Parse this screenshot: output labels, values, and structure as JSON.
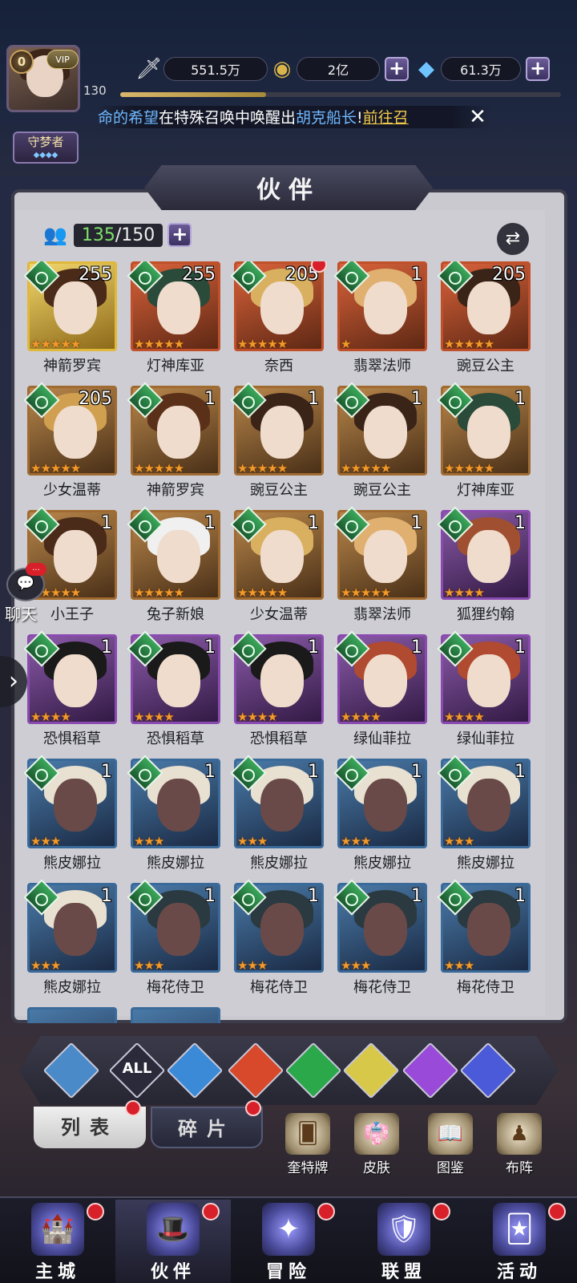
{
  "player": {
    "level_badge": "0",
    "vip_label": "VIP",
    "level": "130",
    "exp_fraction": 0.33,
    "title": "守梦者",
    "title_stars": "◆◆◆◆"
  },
  "resources": {
    "power": "551.5万",
    "gold": "2亿",
    "gems": "61.3万",
    "plus": "+"
  },
  "marquee": {
    "part1": "命的希望",
    "part2": "在特殊召唤中唤醒出",
    "hero": "胡克船长",
    "part3": "!",
    "link": "前往召"
  },
  "panel": {
    "title": "伙伴",
    "capacity_current": "135",
    "capacity_total": "/150"
  },
  "heroes": [
    {
      "name": "神箭罗宾",
      "level": "255",
      "stars": "★★★★★",
      "rarity": "gold",
      "dot": false
    },
    {
      "name": "灯神库亚",
      "level": "255",
      "stars": "★★★★★",
      "rarity": "red",
      "dot": false
    },
    {
      "name": "奈西",
      "level": "205",
      "stars": "★★★★★",
      "rarity": "red",
      "dot": true
    },
    {
      "name": "翡翠法师",
      "level": "1",
      "stars": "★",
      "rarity": "red",
      "dot": false
    },
    {
      "name": "豌豆公主",
      "level": "205",
      "stars": "★★★★★",
      "rarity": "red",
      "dot": false
    },
    {
      "name": "少女温蒂",
      "level": "205",
      "stars": "★★★★★",
      "rarity": "brown",
      "dot": false
    },
    {
      "name": "神箭罗宾",
      "level": "1",
      "stars": "★★★★★",
      "rarity": "brown",
      "dot": false
    },
    {
      "name": "豌豆公主",
      "level": "1",
      "stars": "★★★★★",
      "rarity": "brown",
      "dot": false
    },
    {
      "name": "豌豆公主",
      "level": "1",
      "stars": "★★★★★",
      "rarity": "brown",
      "dot": false
    },
    {
      "name": "灯神库亚",
      "level": "1",
      "stars": "★★★★★",
      "rarity": "brown",
      "dot": false
    },
    {
      "name": "小王子",
      "level": "1",
      "stars": "★★★★★",
      "rarity": "brown",
      "dot": false
    },
    {
      "name": "兔子新娘",
      "level": "1",
      "stars": "★★★★★",
      "rarity": "brown",
      "dot": false
    },
    {
      "name": "少女温蒂",
      "level": "1",
      "stars": "★★★★★",
      "rarity": "brown",
      "dot": false
    },
    {
      "name": "翡翠法师",
      "level": "1",
      "stars": "★★★★★",
      "rarity": "brown",
      "dot": false
    },
    {
      "name": "狐狸约翰",
      "level": "1",
      "stars": "★★★★",
      "rarity": "purple",
      "dot": false
    },
    {
      "name": "恐惧稻草",
      "level": "1",
      "stars": "★★★★",
      "rarity": "purple",
      "dot": false
    },
    {
      "name": "恐惧稻草",
      "level": "1",
      "stars": "★★★★",
      "rarity": "purple",
      "dot": false
    },
    {
      "name": "恐惧稻草",
      "level": "1",
      "stars": "★★★★",
      "rarity": "purple",
      "dot": false
    },
    {
      "name": "绿仙菲拉",
      "level": "1",
      "stars": "★★★★",
      "rarity": "purple",
      "dot": false
    },
    {
      "name": "绿仙菲拉",
      "level": "1",
      "stars": "★★★★",
      "rarity": "purple",
      "dot": false
    },
    {
      "name": "熊皮娜拉",
      "level": "1",
      "stars": "★★★",
      "rarity": "blue",
      "dot": false
    },
    {
      "name": "熊皮娜拉",
      "level": "1",
      "stars": "★★★",
      "rarity": "blue",
      "dot": false
    },
    {
      "name": "熊皮娜拉",
      "level": "1",
      "stars": "★★★",
      "rarity": "blue",
      "dot": false
    },
    {
      "name": "熊皮娜拉",
      "level": "1",
      "stars": "★★★",
      "rarity": "blue",
      "dot": false
    },
    {
      "name": "熊皮娜拉",
      "level": "1",
      "stars": "★★★",
      "rarity": "blue",
      "dot": false
    },
    {
      "name": "熊皮娜拉",
      "level": "1",
      "stars": "★★★",
      "rarity": "blue",
      "dot": false
    },
    {
      "name": "梅花侍卫",
      "level": "1",
      "stars": "★★★",
      "rarity": "blue",
      "dot": false
    },
    {
      "name": "梅花侍卫",
      "level": "1",
      "stars": "★★★",
      "rarity": "blue",
      "dot": false
    },
    {
      "name": "梅花侍卫",
      "level": "1",
      "stars": "★★★",
      "rarity": "blue",
      "dot": false
    },
    {
      "name": "梅花侍卫",
      "level": "1",
      "stars": "★★★",
      "rarity": "blue",
      "dot": false
    }
  ],
  "filters": [
    {
      "icon": "ascend-icon",
      "label": "",
      "color": "#4a8ac8"
    },
    {
      "icon": "all-icon",
      "label": "ALL",
      "color": "#2a2a3a"
    },
    {
      "icon": "water-icon",
      "label": "",
      "color": "#3a8ad8"
    },
    {
      "icon": "fire-icon",
      "label": "",
      "color": "#d8482a"
    },
    {
      "icon": "wind-icon",
      "label": "",
      "color": "#2aa84a"
    },
    {
      "icon": "light-icon",
      "label": "",
      "color": "#d8c84a"
    },
    {
      "icon": "dark-icon",
      "label": "",
      "color": "#9a4ad8"
    },
    {
      "icon": "planet-icon",
      "label": "",
      "color": "#4a5ad8"
    }
  ],
  "tabs": {
    "list": "列表",
    "shards": "碎片"
  },
  "sub_items": [
    {
      "label": "奎特牌",
      "icon": "card-icon"
    },
    {
      "label": "皮肤",
      "icon": "outfit-icon"
    },
    {
      "label": "图鉴",
      "icon": "codex-icon"
    },
    {
      "label": "布阵",
      "icon": "formation-icon"
    }
  ],
  "nav": [
    {
      "label": "主城",
      "icon": "castle-icon",
      "active": false
    },
    {
      "label": "伙伴",
      "icon": "companion-icon",
      "active": true
    },
    {
      "label": "冒险",
      "icon": "adventure-icon",
      "active": false
    },
    {
      "label": "联盟",
      "icon": "alliance-icon",
      "active": false
    },
    {
      "label": "活动",
      "icon": "events-icon",
      "active": false
    }
  ],
  "chat": {
    "label": "聊天",
    "badge": "..."
  }
}
